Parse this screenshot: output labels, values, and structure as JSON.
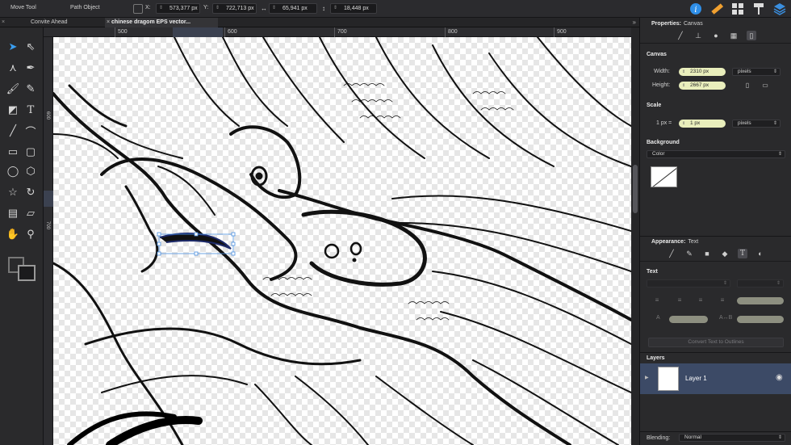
{
  "toolbar": {
    "tool_name": "Move Tool",
    "path_object": "Path Object",
    "x_label": "X:",
    "x_value": "573,377 px",
    "y_label": "Y:",
    "y_value": "722,713 px",
    "width_value": "65,941 px",
    "height_value": "18,448 px",
    "icons": [
      "info-icon",
      "ruler-icon",
      "grid-icon",
      "paint-roller-icon",
      "layers-icon"
    ]
  },
  "tabs": [
    {
      "label": "Convite Ahead",
      "active": false
    },
    {
      "label": "chinese dragom EPS vector...",
      "active": true
    }
  ],
  "ruler": {
    "h_ticks": [
      "500",
      "600",
      "700",
      "800",
      "900"
    ],
    "v_ticks": [
      "600",
      "700"
    ]
  },
  "properties": {
    "title": "Properties:",
    "context": "Canvas",
    "canvas_section": "Canvas",
    "width_label": "Width:",
    "width_value": "2310 px",
    "width_unit": "pixels",
    "height_label": "Height:",
    "height_value": "2667 px",
    "scale_section": "Scale",
    "scale_label": "1 px =",
    "scale_value": "1 px",
    "scale_unit": "pixels",
    "background_section": "Background",
    "background_type": "Color"
  },
  "appearance": {
    "title": "Appearance:",
    "context": "Text",
    "text_section": "Text",
    "av_label": "A",
    "ab_label": "A↔B",
    "convert_button": "Convert Text to Outlines"
  },
  "layers": {
    "title": "Layers",
    "items": [
      {
        "name": "Layer 1"
      }
    ],
    "blending_label": "Blending:",
    "blending_value": "Normal"
  }
}
